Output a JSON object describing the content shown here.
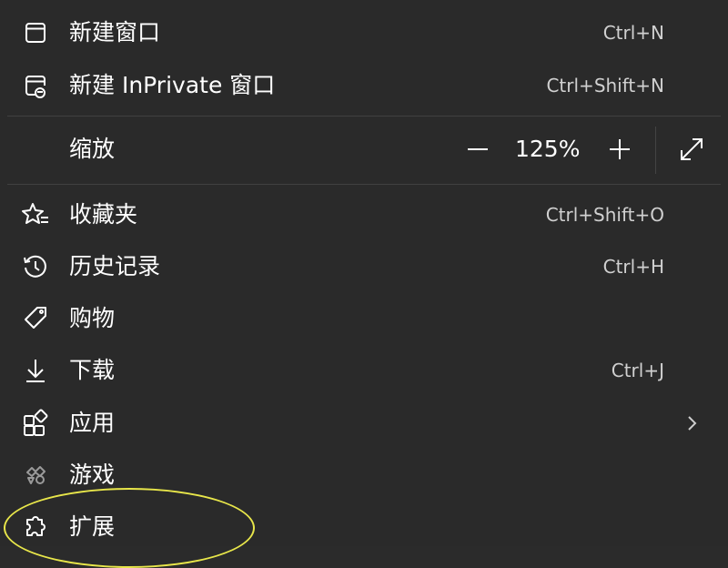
{
  "menu": {
    "new_window": {
      "label": "新建窗口",
      "shortcut": "Ctrl+N",
      "icon": "window-icon"
    },
    "new_inprivate": {
      "label": "新建 InPrivate 窗口",
      "shortcut": "Ctrl+Shift+N",
      "icon": "inprivate-window-icon"
    },
    "zoom": {
      "label": "缩放",
      "value": "125%",
      "minus": "—",
      "plus": "+"
    },
    "favorites": {
      "label": "收藏夹",
      "shortcut": "Ctrl+Shift+O",
      "icon": "favorites-icon"
    },
    "history": {
      "label": "历史记录",
      "shortcut": "Ctrl+H",
      "icon": "history-icon"
    },
    "shopping": {
      "label": "购物",
      "icon": "tag-icon"
    },
    "downloads": {
      "label": "下载",
      "shortcut": "Ctrl+J",
      "icon": "download-icon"
    },
    "apps": {
      "label": "应用",
      "icon": "apps-icon"
    },
    "games": {
      "label": "游戏",
      "icon": "games-icon"
    },
    "extensions": {
      "label": "扩展",
      "icon": "extensions-icon"
    }
  },
  "colors": {
    "background": "#2a2a2a",
    "text": "#ffffff",
    "shortcut_text": "#d0d0d0",
    "divider": "#404040",
    "highlight_circle": "#e8e64a"
  }
}
